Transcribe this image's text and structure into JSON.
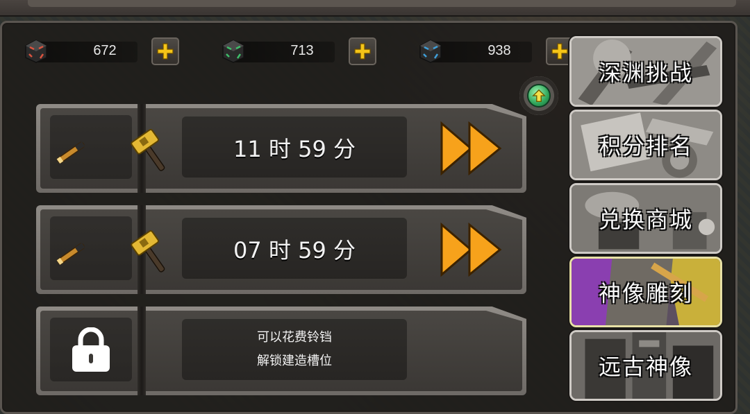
{
  "currencies": [
    {
      "name": "red-cube",
      "amount": "672",
      "color": "#d9533f"
    },
    {
      "name": "green-cube",
      "amount": "713",
      "color": "#3fbf6a"
    },
    {
      "name": "blue-cube",
      "amount": "938",
      "color": "#3f9fd9"
    }
  ],
  "slots": [
    {
      "timer": "11 时 59 分"
    },
    {
      "timer": "07 时 59 分"
    },
    {
      "locked_line1": "可以花费铃铛",
      "locked_line2": "解锁建造槽位"
    }
  ],
  "menu": [
    {
      "label": "深渊挑战"
    },
    {
      "label": "积分排名"
    },
    {
      "label": "兑换商城"
    },
    {
      "label": "神像雕刻"
    },
    {
      "label": "远古神像"
    }
  ],
  "colors": {
    "accent_yellow": "#f5c518",
    "arrow_orange": "#f7a21b",
    "panel": "#3b3835",
    "upgrade_green": "#2fa55a"
  }
}
